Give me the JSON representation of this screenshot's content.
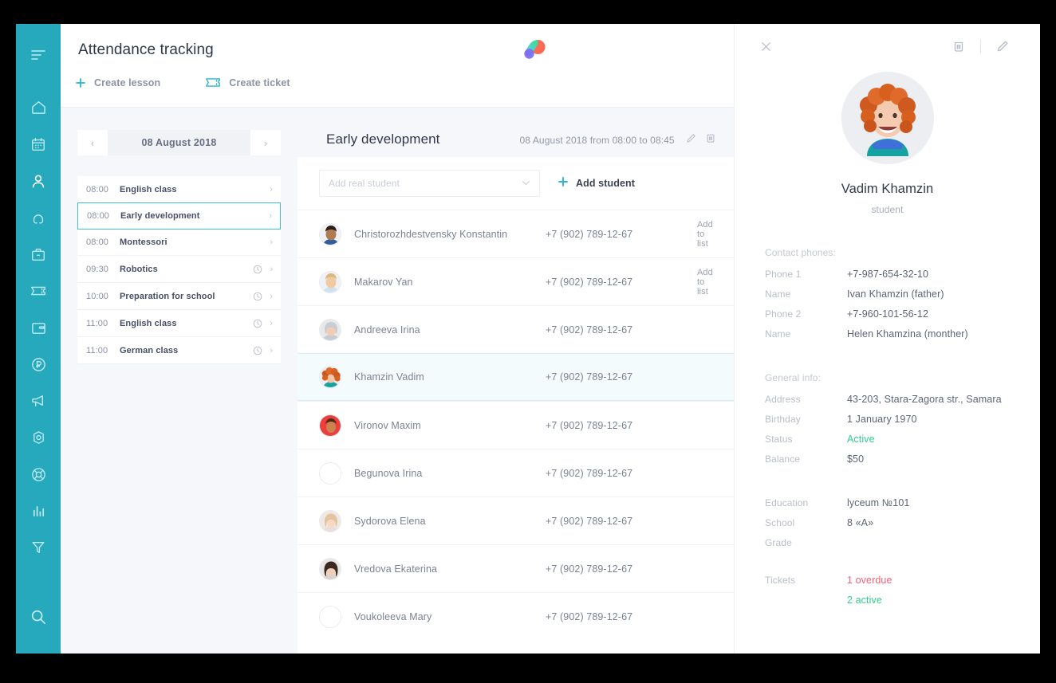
{
  "brand": {
    "sidebar_color": "#27a9bd",
    "accent": "#2bb4d4",
    "green": "#2ecf8d",
    "red": "#fa5f74"
  },
  "header": {
    "title": "Attendance tracking",
    "create_lesson": "Create lesson",
    "create_ticket": "Create ticket"
  },
  "sidebar": {
    "items": [
      {
        "icon": "menu-icon",
        "name": "sidebar-item-menu"
      },
      {
        "icon": "home-icon",
        "name": "sidebar-item-home"
      },
      {
        "icon": "calendar-icon",
        "name": "sidebar-item-calendar"
      },
      {
        "icon": "user-icon",
        "name": "sidebar-item-users"
      },
      {
        "icon": "teacher-icon",
        "name": "sidebar-item-teachers"
      },
      {
        "icon": "briefcase-icon",
        "name": "sidebar-item-briefcase"
      },
      {
        "icon": "ticket-icon",
        "name": "sidebar-item-tickets"
      },
      {
        "icon": "wallet-icon",
        "name": "sidebar-item-wallet"
      },
      {
        "icon": "ruble-icon",
        "name": "sidebar-item-finance"
      },
      {
        "icon": "megaphone-icon",
        "name": "sidebar-item-marketing"
      },
      {
        "icon": "settings-icon",
        "name": "sidebar-item-settings"
      },
      {
        "icon": "lifebuoy-icon",
        "name": "sidebar-item-support"
      },
      {
        "icon": "chart-bar-icon",
        "name": "sidebar-item-reports"
      },
      {
        "icon": "funnel-icon",
        "name": "sidebar-item-filters"
      }
    ],
    "search_icon": "search-icon"
  },
  "schedule": {
    "date": "08 August 2018",
    "prev": "‹",
    "next": "›",
    "lessons": [
      {
        "time": "08:00",
        "name": "English class",
        "clock": false,
        "selected": false
      },
      {
        "time": "08:00",
        "name": "Early development",
        "clock": false,
        "selected": true
      },
      {
        "time": "08:00",
        "name": "Montessori",
        "clock": false,
        "selected": false
      },
      {
        "time": "09:30",
        "name": "Robotics",
        "clock": true,
        "selected": false
      },
      {
        "time": "10:00",
        "name": "Preparation for school",
        "clock": true,
        "selected": false
      },
      {
        "time": "11:00",
        "name": "English class",
        "clock": true,
        "selected": false
      },
      {
        "time": "11:00",
        "name": "German class",
        "clock": true,
        "selected": false
      }
    ]
  },
  "lesson": {
    "title": "Early development",
    "meta": "08 August 2018 from 08:00 to 08:45",
    "edit_icon": "pencil-icon",
    "delete_icon": "trash-icon",
    "add_select_placeholder": "Add real student",
    "add_student_label": "Add student",
    "students": [
      {
        "name": "Christorozhdestvensky Konstantin",
        "phone": "+7 (902) 789-12-67",
        "action": "Add to list",
        "selected": false,
        "avatar": "boy-dark"
      },
      {
        "name": "Makarov Yan",
        "phone": "+7 (902) 789-12-67",
        "action": "Add to list",
        "selected": false,
        "avatar": "boy-blond"
      },
      {
        "name": "Andreeva Irina",
        "phone": "+7 (902) 789-12-67",
        "action": "",
        "selected": false,
        "avatar": "girl-grey"
      },
      {
        "name": "Khamzin Vadim",
        "phone": "+7 (902) 789-12-67",
        "action": "",
        "selected": true,
        "avatar": "girl-red"
      },
      {
        "name": "Vironov Maxim",
        "phone": "+7 (902) 789-12-67",
        "action": "",
        "selected": false,
        "avatar": "red-bg"
      },
      {
        "name": "Begunova Irina",
        "phone": "+7 (902) 789-12-67",
        "action": "",
        "selected": false,
        "avatar": "empty"
      },
      {
        "name": "Sydorova Elena",
        "phone": "+7 (902) 789-12-67",
        "action": "",
        "selected": false,
        "avatar": "girl-pale"
      },
      {
        "name": "Vredova Ekaterina",
        "phone": "+7 (902) 789-12-67",
        "action": "",
        "selected": false,
        "avatar": "girl-dark"
      },
      {
        "name": "Voukoleeva Mary",
        "phone": "+7 (902) 789-12-67",
        "action": "",
        "selected": false,
        "avatar": "empty"
      }
    ]
  },
  "detail": {
    "close_icon": "close-icon",
    "delete_icon": "trash-icon",
    "edit_icon": "pencil-icon",
    "name": "Vadim Khamzin",
    "role": "student",
    "contacts_title": "Contact phones:",
    "contacts": [
      {
        "label": "Phone 1",
        "value": "+7-987-654-32-10"
      },
      {
        "label": "Name",
        "value": "Ivan Khamzin (father)"
      },
      {
        "label": "Phone 2",
        "value": "+7-960-101-56-12"
      },
      {
        "label": "Name",
        "value": "Helen Khamzina (monther)"
      }
    ],
    "general_title": "General info:",
    "general": [
      {
        "label": "Address",
        "value": "43-203, Stara-Zagora str., Samara",
        "style": ""
      },
      {
        "label": "Birthday",
        "value": "1 January 1970",
        "style": ""
      },
      {
        "label": "Status",
        "value": "Active",
        "style": "green"
      },
      {
        "label": "Balance",
        "value": "$50",
        "style": ""
      }
    ],
    "education": [
      {
        "label": "Education",
        "value": "lyceum №101",
        "style": ""
      },
      {
        "label": "School",
        "value": "8 «А»",
        "style": ""
      },
      {
        "label": "Grade",
        "value": "",
        "style": ""
      }
    ],
    "tickets_label": "Tickets",
    "tickets": [
      {
        "value": "1 overdue",
        "style": "red"
      },
      {
        "value": "2 active",
        "style": "green"
      }
    ]
  }
}
